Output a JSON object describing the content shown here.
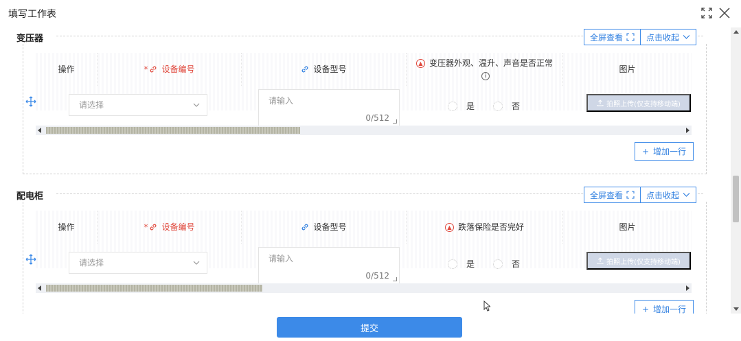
{
  "window": {
    "title": "填写工作表"
  },
  "sections": [
    {
      "title": "变压器",
      "fullscreen_label": "全屏查看",
      "collapse_label": "点击收起",
      "headers": {
        "op": "操作",
        "code": "设备编号",
        "model": "设备型号",
        "question": "变压器外观、温升、声音是否正常",
        "image": "图片"
      },
      "row": {
        "select_placeholder": "请选择",
        "input_placeholder": "请输入",
        "char_count": "0/512",
        "yes": "是",
        "no": "否",
        "upload": "拍照上传(仅支持移动端)"
      },
      "scroll_fraction": 0.4,
      "add_row": "增加一行"
    },
    {
      "title": "配电柜",
      "fullscreen_label": "全屏查看",
      "collapse_label": "点击收起",
      "headers": {
        "op": "操作",
        "code": "设备编号",
        "model": "设备型号",
        "question": "跌落保险是否完好",
        "image": "图片"
      },
      "row": {
        "select_placeholder": "请选择",
        "input_placeholder": "请输入",
        "char_count": "0/512",
        "yes": "是",
        "no": "否",
        "upload": "拍照上传(仅支持移动端)"
      },
      "scroll_fraction": 0.34,
      "add_row": "增加一行"
    }
  ],
  "footer": {
    "submit": "提交"
  },
  "colors": {
    "primary": "#3c8ae8",
    "required": "#e0463a",
    "disabled_upload": "#cfd7e6"
  }
}
